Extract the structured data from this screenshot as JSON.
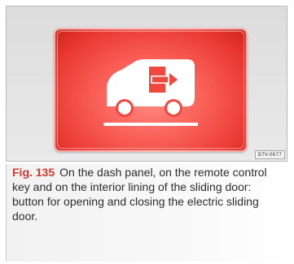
{
  "figure": {
    "button_color": "#f04a42",
    "icon": "van-sliding-door-open-close-icon",
    "reference_code": "B7V-0677"
  },
  "caption": {
    "label": "Fig. 135",
    "text": "On the dash panel, on the remote control key and on the interior lining of the sliding door: button for opening and closing the electric sliding door."
  }
}
